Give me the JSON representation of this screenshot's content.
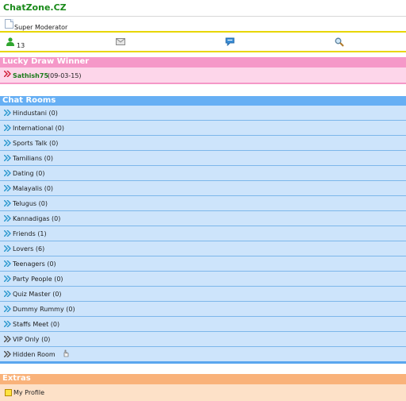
{
  "brand": {
    "title": "ChatZone.CZ"
  },
  "user": {
    "role": "Super Moderator"
  },
  "toolbar": {
    "online_count": "13"
  },
  "lucky": {
    "header": "Lucky Draw Winner",
    "winner": "Sathish75",
    "date": "(09-03-15)"
  },
  "rooms": {
    "header": "Chat Rooms",
    "items": [
      {
        "label": "Hindustani (0)"
      },
      {
        "label": "International (0)"
      },
      {
        "label": "Sports Talk (0)"
      },
      {
        "label": "Tamilians (0)"
      },
      {
        "label": "Dating (0)"
      },
      {
        "label": "Malayalis (0)"
      },
      {
        "label": "Telugus (0)"
      },
      {
        "label": "Kannadigas (0)"
      },
      {
        "label": "Friends (1)"
      },
      {
        "label": "Lovers (6)"
      },
      {
        "label": "Teenagers (0)"
      },
      {
        "label": "Party People (0)"
      },
      {
        "label": "Quiz Master (0)"
      },
      {
        "label": "Dummy Rummy (0)"
      },
      {
        "label": "Staffs Meet (0)"
      },
      {
        "label": "VIP Only (0)"
      },
      {
        "label": "Hidden Room"
      }
    ]
  },
  "extras": {
    "header": "Extras",
    "items": [
      {
        "label": "My Profile"
      }
    ]
  },
  "colors": {
    "brand_green": "#1a8a1a",
    "lucky_pink": "#f598c8",
    "rooms_blue": "#66aff4",
    "extras_orange": "#f9b27a",
    "divider_yellow": "#e8d600"
  }
}
